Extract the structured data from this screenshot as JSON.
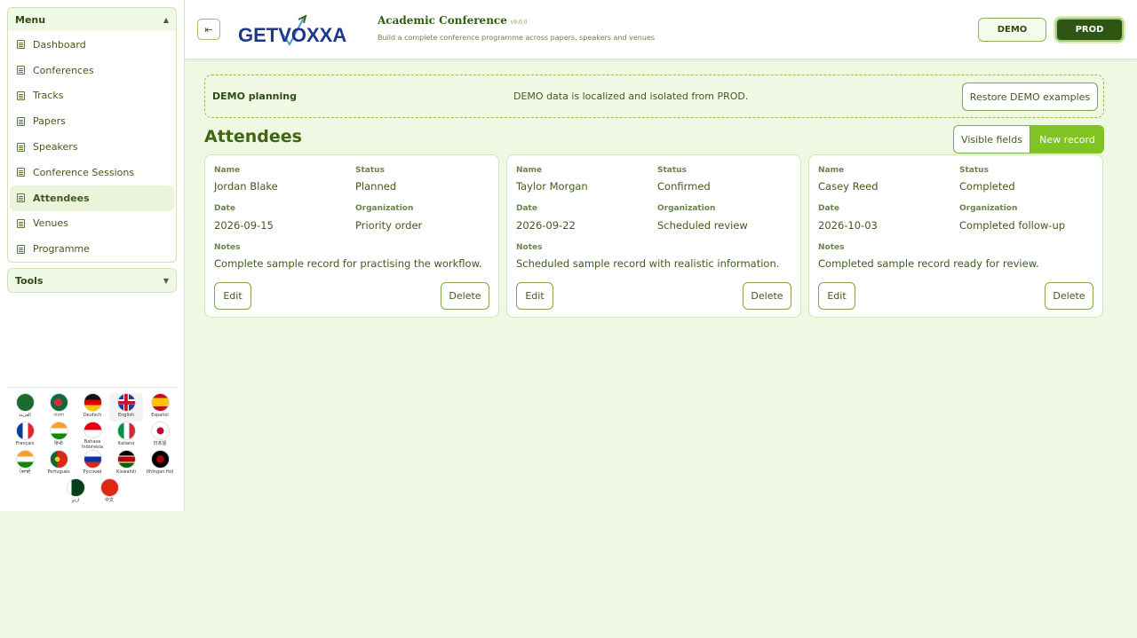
{
  "sidebar": {
    "menu_title": "Menu",
    "items": [
      {
        "label": "Dashboard"
      },
      {
        "label": "Conferences"
      },
      {
        "label": "Tracks"
      },
      {
        "label": "Papers"
      },
      {
        "label": "Speakers"
      },
      {
        "label": "Conference Sessions"
      },
      {
        "label": "Attendees",
        "active": true
      },
      {
        "label": "Venues"
      },
      {
        "label": "Programme"
      }
    ],
    "tools_title": "Tools",
    "languages": [
      {
        "label": "العربية",
        "icon": "flag-saudi-arabia-icon"
      },
      {
        "label": "বাংলা",
        "icon": "flag-bangladesh-icon"
      },
      {
        "label": "Deutsch",
        "icon": "flag-germany-icon"
      },
      {
        "label": "English",
        "icon": "flag-uk-icon"
      },
      {
        "label": "Español",
        "icon": "flag-spain-icon"
      },
      {
        "label": "Français",
        "icon": "flag-france-icon"
      },
      {
        "label": "हिन्दी",
        "icon": "flag-india-icon"
      },
      {
        "label": "Bahasa Indonesia",
        "icon": "flag-indonesia-icon"
      },
      {
        "label": "Italiano",
        "icon": "flag-italy-icon"
      },
      {
        "label": "日本語",
        "icon": "flag-japan-icon"
      },
      {
        "label": "ਪੰਜਾਬੀ",
        "icon": "flag-india-icon"
      },
      {
        "label": "Português",
        "icon": "flag-portugal-icon"
      },
      {
        "label": "Русский",
        "icon": "flag-russia-icon"
      },
      {
        "label": "Kiswahili",
        "icon": "flag-kenya-icon"
      },
      {
        "label": "tlhIngan Hol",
        "icon": "flag-klingon-icon"
      },
      {
        "label": "اردو",
        "icon": "flag-pakistan-icon"
      },
      {
        "label": "中文",
        "icon": "flag-china-icon"
      }
    ]
  },
  "header": {
    "logo_text": "GETVOXXA",
    "title": "Academic Conference",
    "version": "v9.0.0",
    "subtitle": "Build a complete conference programme across papers, speakers and venues",
    "demo_label": "DEMO",
    "prod_label": "PROD"
  },
  "banner": {
    "title": "DEMO planning",
    "message": "DEMO data is localized and isolated from PROD.",
    "restore_label": "Restore DEMO examples"
  },
  "section": {
    "title": "Attendees",
    "visible_fields_label": "Visible fields",
    "new_record_label": "New record"
  },
  "field_labels": {
    "name": "Name",
    "status": "Status",
    "date": "Date",
    "organization": "Organization",
    "notes": "Notes",
    "edit": "Edit",
    "delete": "Delete"
  },
  "records": [
    {
      "name": "Jordan Blake",
      "status": "Planned",
      "date": "2026-09-15",
      "organization": "Priority order",
      "notes": "Complete sample record for practising the workflow."
    },
    {
      "name": "Taylor Morgan",
      "status": "Confirmed",
      "date": "2026-09-22",
      "organization": "Scheduled review",
      "notes": "Scheduled sample record with realistic information."
    },
    {
      "name": "Casey Reed",
      "status": "Completed",
      "date": "2026-10-03",
      "organization": "Completed follow-up",
      "notes": "Completed sample record ready for review."
    }
  ],
  "colors": {
    "accent": "#7fc424",
    "prod_bg": "#2f5512",
    "page_bg": "#eef8e2"
  }
}
